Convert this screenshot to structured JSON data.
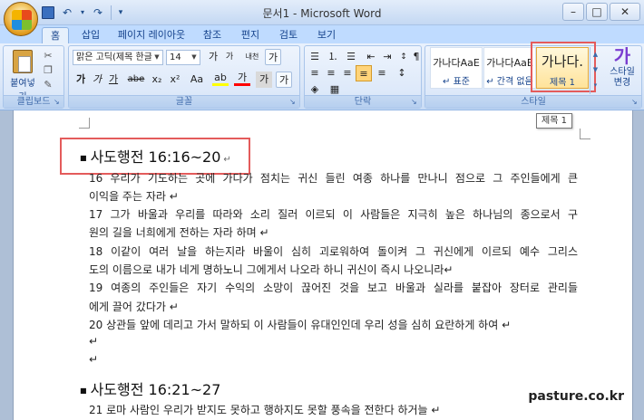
{
  "window": {
    "title": "문서1 - Microsoft Word",
    "minimize": "–",
    "maximize": "□",
    "close": "✕"
  },
  "qat": {
    "undo": "↶",
    "redo": "↷",
    "customize": "▾"
  },
  "tabs": [
    "홈",
    "삽입",
    "페이지 레이아웃",
    "참조",
    "편지",
    "검토",
    "보기"
  ],
  "active_tab": "홈",
  "ribbon": {
    "clipboard": {
      "label": "클립보드",
      "paste_label": "붙여넣기",
      "cut_icon": "✂",
      "copy_icon": "❐",
      "format_painter_icon": "✎"
    },
    "font": {
      "label": "글꼴",
      "font_name": "맑은 고딕(제목 한글",
      "font_size": "14",
      "grow": "가",
      "shrink": "가",
      "hangul_phonetic": "내천",
      "clear_format": "가",
      "bold": "가",
      "italic": "가",
      "underline": "가",
      "strike": "abe",
      "subscript": "x₂",
      "superscript": "x²",
      "change_case": "Aa",
      "highlight": "ab",
      "font_color": "가",
      "char_shade": "가",
      "char_border": "가"
    },
    "paragraph": {
      "label": "단락",
      "bullets": "☰",
      "numbering": "⒈",
      "multilevel": "☰",
      "decrease_indent": "⇤",
      "increase_indent": "⇥",
      "sort": "↕",
      "show_marks": "¶",
      "align_left": "≡",
      "align_center": "≡",
      "align_right": "≡",
      "justify": "≡",
      "distribute": "≡",
      "line_spacing": "↕",
      "shading": "◈",
      "borders": "▦"
    },
    "styles": {
      "label": "스타일",
      "items": [
        {
          "preview": "가나다AaE",
          "name": "↵ 표준"
        },
        {
          "preview": "가나다AaE",
          "name": "↵ 간격 없음"
        },
        {
          "preview": "가나다.",
          "name": "제목 1"
        }
      ],
      "change_styles_glyph": "가",
      "change_styles_label_1": "스타일",
      "change_styles_label_2": "변경"
    },
    "launcher": "↘"
  },
  "tooltip": "제목 1",
  "document": {
    "heading1": "사도행전 16:16~20",
    "heading2": "사도행전 16:21~27",
    "lines": [
      "16 우리가 기도하는 곳에 가다가 점치는 귀신 들린 여종 하나를 만나니 점으로 그 주인들에게 큰",
      "이익을 주는 자라 ↵",
      "17 그가 바울과 우리를 따라와 소리 질러 이르되 이 사람들은 지극히 높은 하나님의 종으로서 구",
      "원의 길을 너희에게 전하는 자라 하며 ↵",
      "18 이같이 여러 날을 하는지라 바울이 심히 괴로워하여 돌이켜 그 귀신에게 이르되 예수 그리스",
      "도의 이름으로 내가 네게 명하노니 그에게서 나오라 하니 귀신이 즉시 나오니라↵",
      "19 여종의 주인들은 자기 수익의 소망이 끊어진 것을 보고 바울과 실라를 붙잡아 장터로 관리들",
      "에게 끌어 갔다가 ↵",
      "20 상관들 앞에 데리고 가서 말하되 이 사람들이 유대인인데 우리 성을 심히 요란하게 하여 ↵",
      "↵",
      "↵"
    ],
    "line21": "21 로마 사람인 우리가 받지도 못하고 행하지도 못할 풍속을 전한다 하거늘 ↵",
    "para_mark": "↵"
  },
  "watermark": "pasture.co.kr"
}
